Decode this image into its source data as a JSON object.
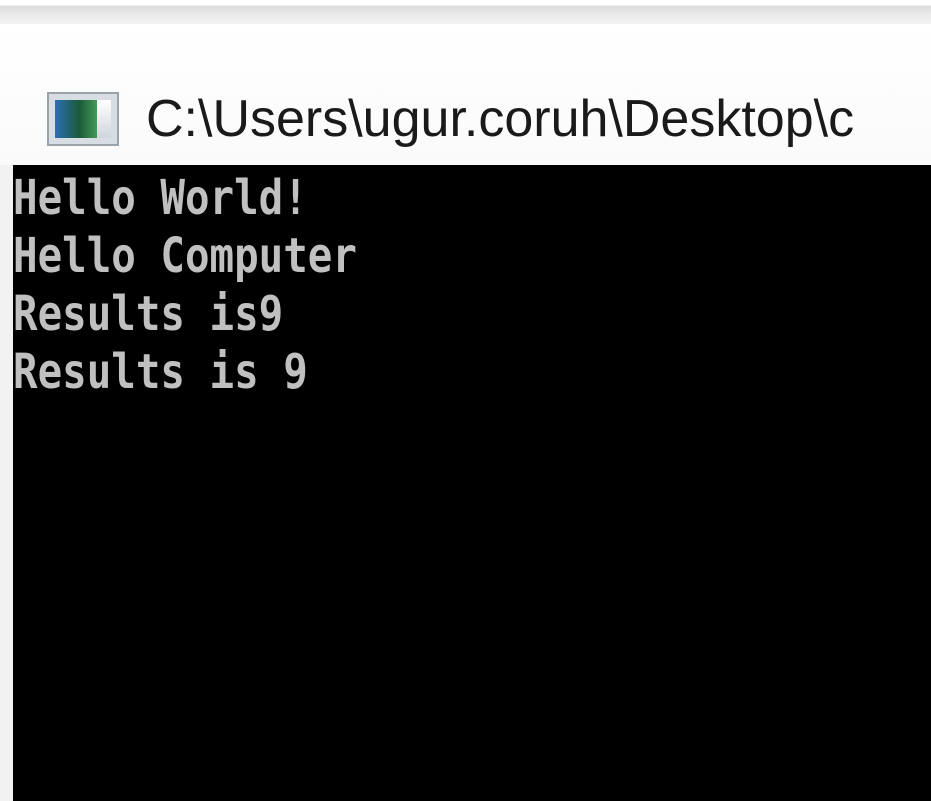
{
  "window": {
    "title": "C:\\Users\\ugur.coruh\\Desktop\\c",
    "icon": "console-window-icon"
  },
  "console": {
    "background": "#000000",
    "text_color": "#c0c0c0",
    "lines": [
      "Hello World!",
      "Hello Computer",
      "Results is9",
      "Results is 9"
    ]
  }
}
